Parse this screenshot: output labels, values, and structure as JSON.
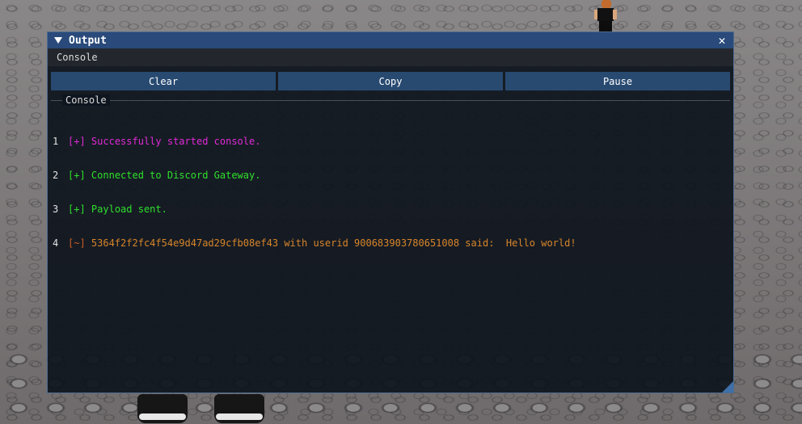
{
  "window": {
    "title": "Output",
    "close_symbol": "✕",
    "menu_label": "Console"
  },
  "toolbar": {
    "clear_label": "Clear",
    "copy_label": "Copy",
    "pause_label": "Pause"
  },
  "console": {
    "group_label": "Console",
    "lines": [
      {
        "num": "1",
        "tag": "[+]",
        "text": "Successfully started console.",
        "color": "#e12ad8"
      },
      {
        "num": "2",
        "tag": "[+]",
        "text": "Connected to Discord Gateway.",
        "color": "#2fe02c"
      },
      {
        "num": "3",
        "tag": "[+]",
        "text": "Payload sent.",
        "color": "#2fe02c"
      },
      {
        "num": "4",
        "tag": "[~]",
        "text": "5364f2f2fc4f54e9d47ad29cfb08ef43 with userid 900683903780651008 said:  Hello world!",
        "color": "#d8852a"
      }
    ]
  },
  "icons": {
    "collapse": "collapse-triangle-icon",
    "close": "close-icon",
    "resize": "resize-grip-icon"
  },
  "colors": {
    "titlebar": "#294a7a",
    "button": "#284a71",
    "window_bg": "#0e141d"
  }
}
